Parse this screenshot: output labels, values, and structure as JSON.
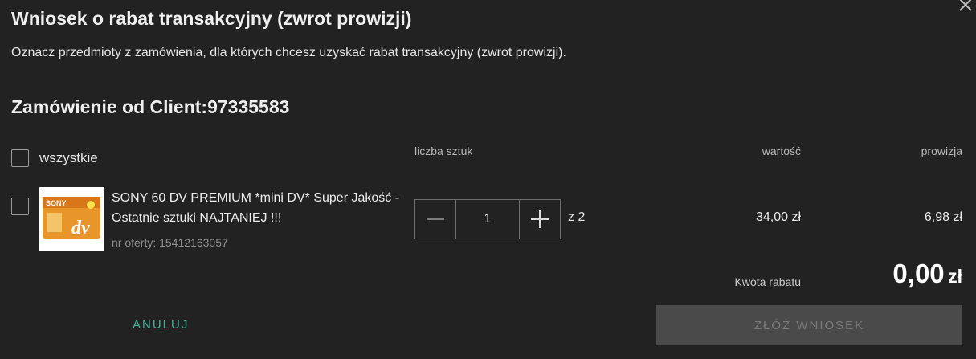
{
  "dialog": {
    "title": "Wniosek o rabat transakcyjny (zwrot prowizji)",
    "subtitle": "Oznacz przedmioty z zamówienia, dla których chcesz uzyskać rabat transakcyjny (zwrot prowizji).",
    "order_title": "Zamówienie od Client:97335583"
  },
  "table": {
    "select_all_label": "wszystkie",
    "select_all_checked": false,
    "headers": {
      "quantity": "liczba sztuk",
      "value": "wartość",
      "commission": "prowizja"
    },
    "items": [
      {
        "checked": false,
        "name": "SONY 60 DV PREMIUM *mini DV* Super Jakość - Ostatnie sztuki NAJTANIEJ !!!",
        "offer_number": "nr oferty: 15412163057",
        "quantity": "1",
        "of_total": "z 2",
        "value": "34,00 zł",
        "commission": "6,98 zł",
        "thumbnail_text": "dv",
        "thumbnail_brand": "SONY"
      }
    ]
  },
  "summary": {
    "rebate_label": "Kwota rabatu",
    "rebate_major": "0,00",
    "rebate_currency": "zł"
  },
  "actions": {
    "cancel_label": "ANULUJ",
    "submit_label": "ZŁÓŻ WNIOSEK"
  },
  "colors": {
    "background": "#222222",
    "accent": "#3fb596",
    "disabled_button": "#4a4a4a"
  }
}
